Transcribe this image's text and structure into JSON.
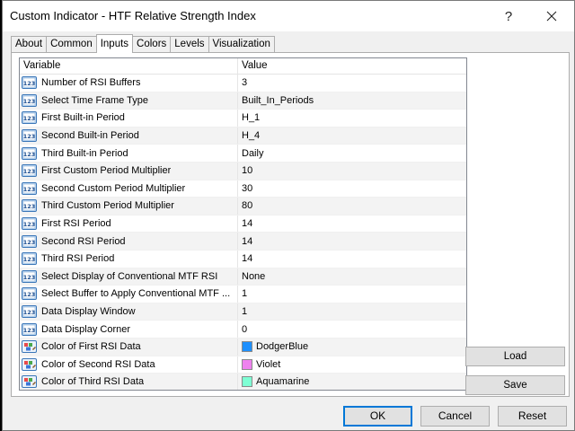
{
  "window": {
    "title": "Custom Indicator - HTF Relative Strength Index",
    "help_label": "?"
  },
  "tabs": [
    {
      "label": "About"
    },
    {
      "label": "Common"
    },
    {
      "label": "Inputs"
    },
    {
      "label": "Colors"
    },
    {
      "label": "Levels"
    },
    {
      "label": "Visualization"
    }
  ],
  "grid": {
    "header_variable": "Variable",
    "header_value": "Value",
    "rows": [
      {
        "variable": "Number of RSI Buffers",
        "value": "3",
        "icon": "numeric-param-icon"
      },
      {
        "variable": "Select Time Frame Type",
        "value": "Built_In_Periods",
        "icon": "numeric-param-icon"
      },
      {
        "variable": "First Built-in Period",
        "value": "H_1",
        "icon": "numeric-param-icon"
      },
      {
        "variable": "Second Built-in Period",
        "value": "H_4",
        "icon": "numeric-param-icon"
      },
      {
        "variable": "Third Built-in Period",
        "value": "Daily",
        "icon": "numeric-param-icon"
      },
      {
        "variable": "First Custom Period Multiplier",
        "value": "10",
        "icon": "numeric-param-icon"
      },
      {
        "variable": "Second Custom Period Multiplier",
        "value": "30",
        "icon": "numeric-param-icon"
      },
      {
        "variable": "Third Custom Period Multiplier",
        "value": "80",
        "icon": "numeric-param-icon"
      },
      {
        "variable": "First RSI Period",
        "value": "14",
        "icon": "numeric-param-icon"
      },
      {
        "variable": "Second RSI Period",
        "value": "14",
        "icon": "numeric-param-icon"
      },
      {
        "variable": "Third RSI Period",
        "value": "14",
        "icon": "numeric-param-icon"
      },
      {
        "variable": "Select Display of Conventional MTF RSI",
        "value": "None",
        "icon": "numeric-param-icon"
      },
      {
        "variable": "Select Buffer to Apply Conventional MTF ...",
        "value": "1",
        "icon": "numeric-param-icon"
      },
      {
        "variable": "Data Display Window",
        "value": "1",
        "icon": "numeric-param-icon"
      },
      {
        "variable": "Data Display Corner",
        "value": "0",
        "icon": "numeric-param-icon"
      },
      {
        "variable": "Color of First RSI Data",
        "value": "DodgerBlue",
        "icon": "color-param-icon",
        "swatch": "#1e90ff"
      },
      {
        "variable": "Color of Second RSI Data",
        "value": "Violet",
        "icon": "color-param-icon",
        "swatch": "#ee82ee"
      },
      {
        "variable": "Color of Third RSI Data",
        "value": "Aquamarine",
        "icon": "color-param-icon",
        "swatch": "#7fffd4"
      }
    ]
  },
  "side_buttons": {
    "load": "Load",
    "save": "Save"
  },
  "footer": {
    "ok": "OK",
    "cancel": "Cancel",
    "reset": "Reset"
  },
  "colors": {
    "accent": "#0078d7"
  }
}
